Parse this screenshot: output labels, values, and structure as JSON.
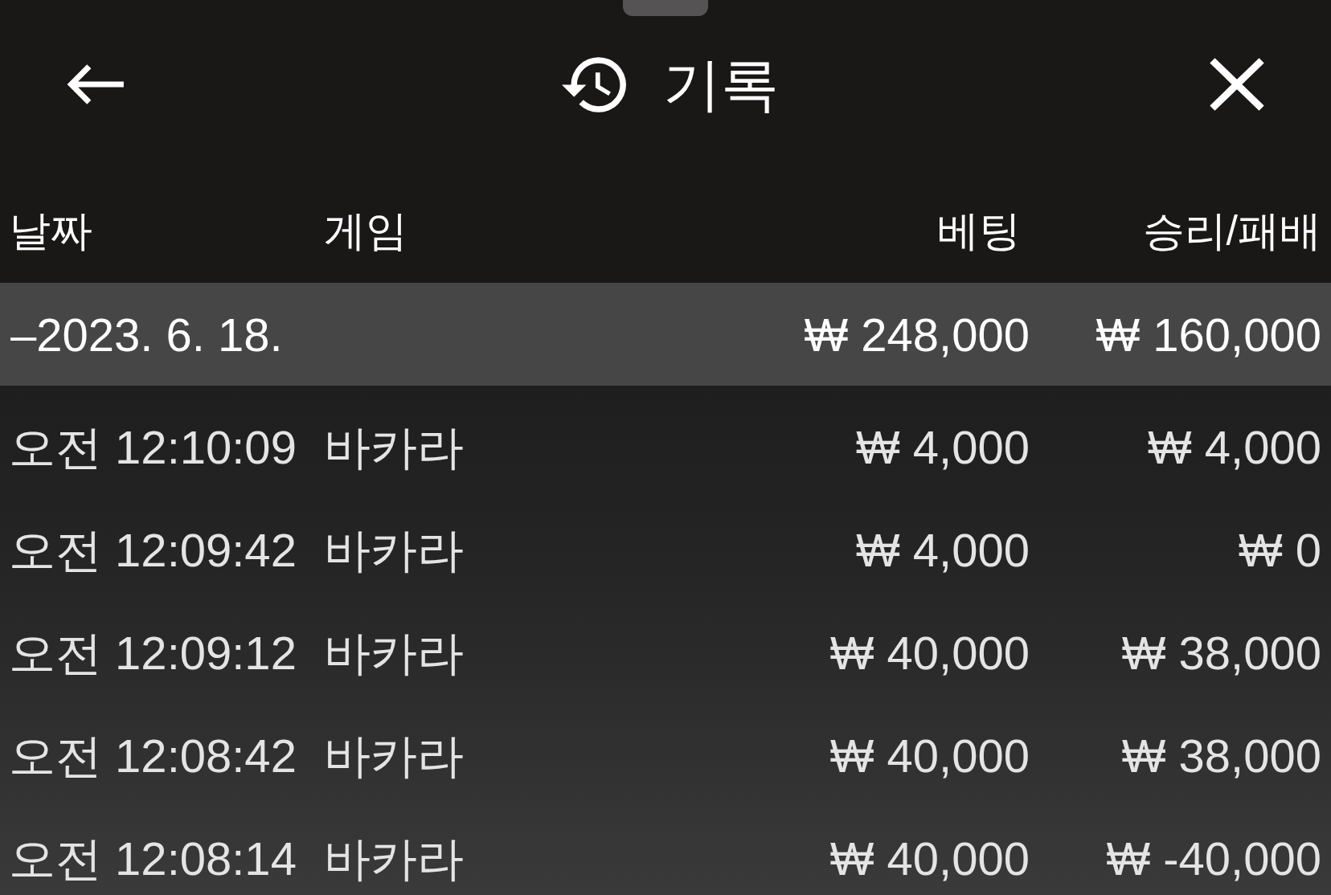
{
  "header": {
    "title": "기록"
  },
  "table": {
    "columns": [
      "날짜",
      "게임",
      "베팅",
      "승리/패배"
    ],
    "groups": [
      {
        "date": "–2023. 6. 18.",
        "bet": "₩ 248,000",
        "result": "₩ 160,000",
        "expanded": true,
        "rows": [
          {
            "time": "오전 12:10:09",
            "game": "바카라",
            "bet": "₩ 4,000",
            "result": "₩ 4,000"
          },
          {
            "time": "오전 12:09:42",
            "game": "바카라",
            "bet": "₩ 4,000",
            "result": "₩ 0"
          },
          {
            "time": "오전 12:09:12",
            "game": "바카라",
            "bet": "₩ 40,000",
            "result": "₩ 38,000"
          },
          {
            "time": "오전 12:08:42",
            "game": "바카라",
            "bet": "₩ 40,000",
            "result": "₩ 38,000"
          },
          {
            "time": "오전 12:08:14",
            "game": "바카라",
            "bet": "₩ 40,000",
            "result": "₩ -40,000"
          }
        ]
      }
    ]
  }
}
